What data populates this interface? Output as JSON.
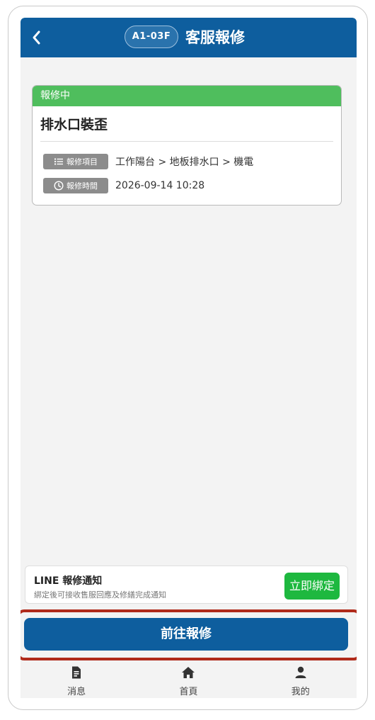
{
  "header": {
    "back_glyph": "<",
    "unit_badge": "A1-03F",
    "title": "客服報修"
  },
  "repair_card": {
    "status": "報修中",
    "title": "排水口裝歪",
    "item_tag": "報修項目",
    "item_value": "工作陽台 > 地板排水口 > 機電",
    "time_tag": "報修時間",
    "time_value": "2026-09-14 10:28",
    "status_color": "#4fbe5d"
  },
  "line_notify": {
    "title": "LINE 報修通知",
    "description": "綁定後可接收售服回應及修繕完成通知",
    "bind_button": "立即綁定"
  },
  "primary_button": "前往報修",
  "tabbar": {
    "items": [
      {
        "label": "消息",
        "icon": "document-icon"
      },
      {
        "label": "首頁",
        "icon": "home-icon"
      },
      {
        "label": "我的",
        "icon": "user-icon"
      }
    ]
  },
  "colors": {
    "brand": "#0e5e9e",
    "line_green": "#1eb83f",
    "highlight": "#b02a1a"
  }
}
